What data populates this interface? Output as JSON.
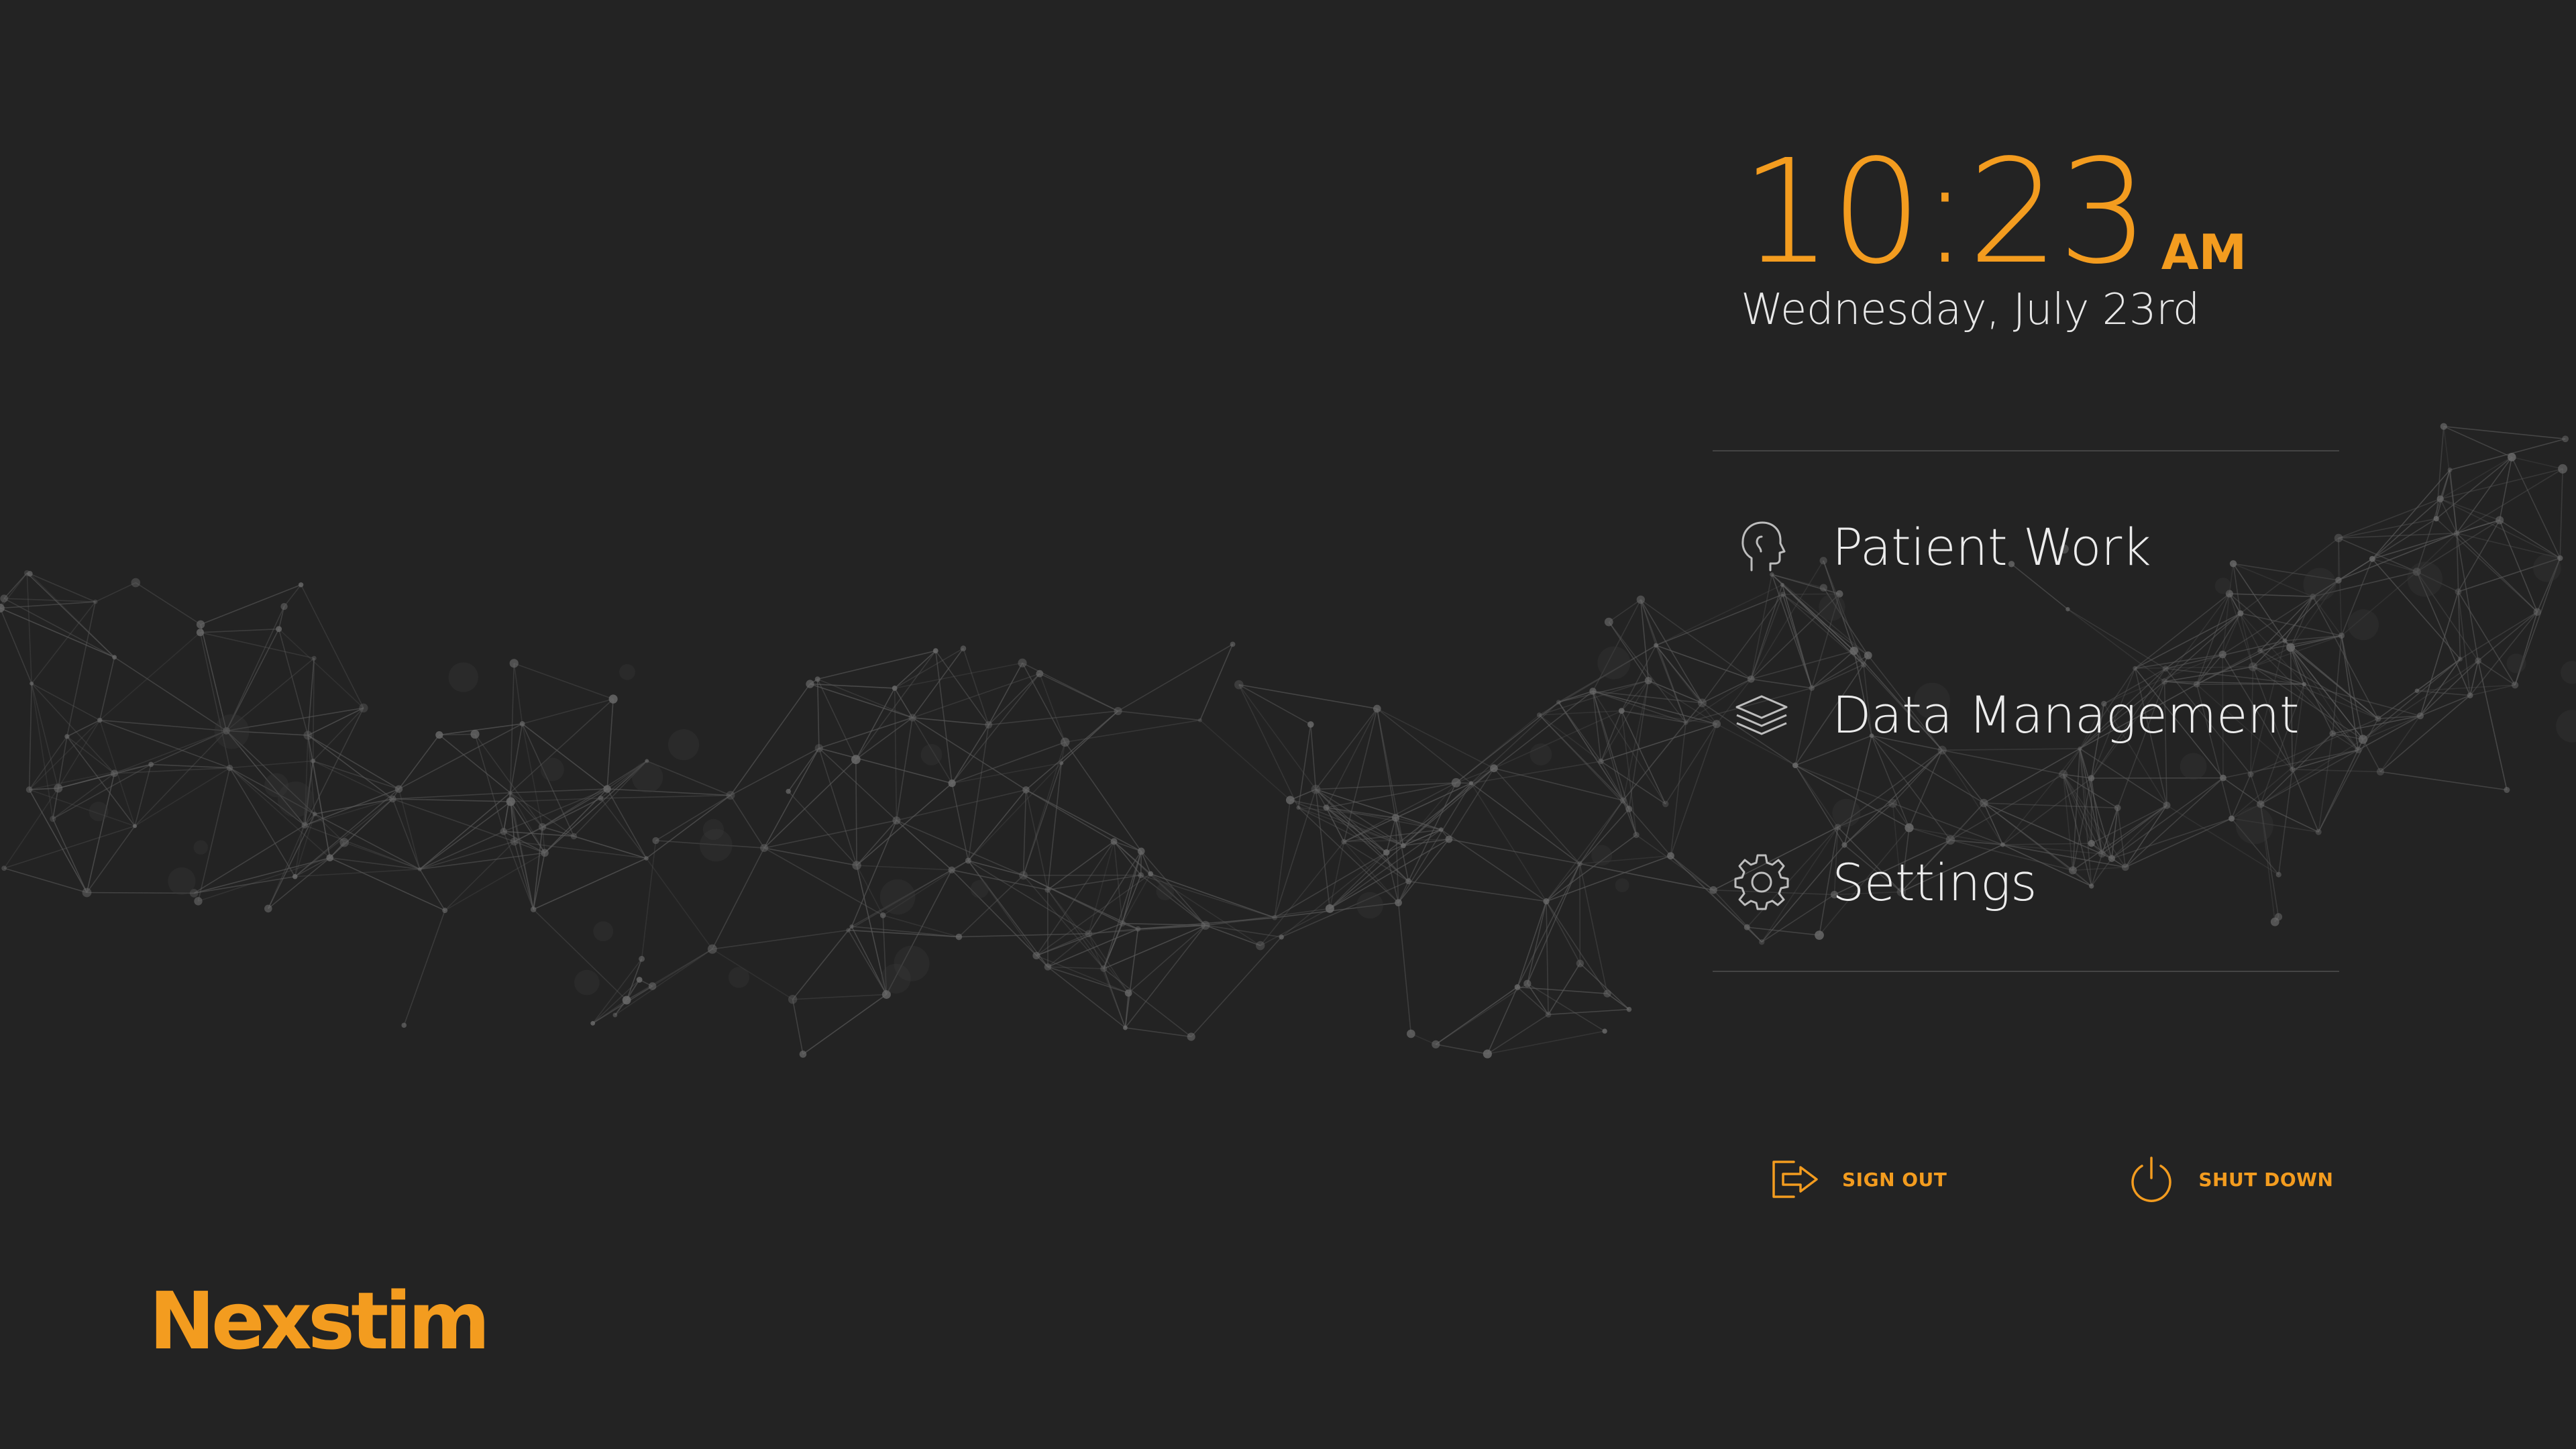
{
  "clock": {
    "time": "10:23",
    "ampm": "AM",
    "date": "Wednesday, July 23rd"
  },
  "menu": {
    "items": [
      {
        "label": "Patient Work",
        "icon": "head-profile-icon"
      },
      {
        "label": "Data Management",
        "icon": "layers-icon"
      },
      {
        "label": "Settings",
        "icon": "gear-icon"
      }
    ]
  },
  "actions": {
    "sign_out": {
      "label": "SIGN OUT",
      "icon": "sign-out-icon"
    },
    "shut_down": {
      "label": "SHUT DOWN",
      "icon": "power-icon"
    }
  },
  "brand": {
    "logo_text": "Nexstim"
  },
  "colors": {
    "accent": "#f39c1f",
    "background": "#232323",
    "text": "#ececec",
    "divider": "#444444"
  }
}
